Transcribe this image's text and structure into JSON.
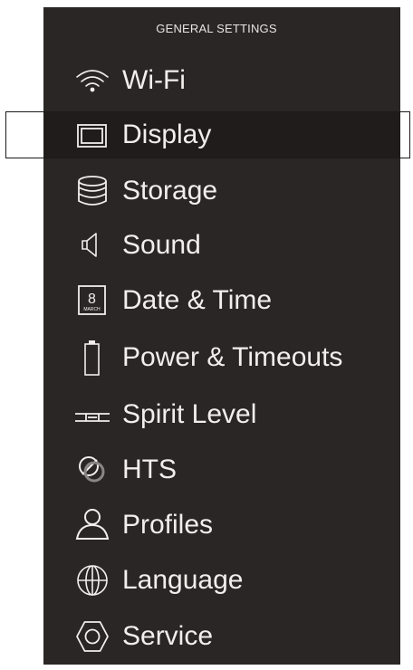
{
  "header": {
    "title": "GENERAL SETTINGS"
  },
  "menu": {
    "selected_index": 1,
    "items": [
      {
        "label": "Wi-Fi",
        "icon": "wifi-icon"
      },
      {
        "label": "Display",
        "icon": "display-icon"
      },
      {
        "label": "Storage",
        "icon": "storage-icon"
      },
      {
        "label": "Sound",
        "icon": "speaker-icon"
      },
      {
        "label": "Date & Time",
        "icon": "calendar-icon",
        "icon_text": {
          "day": "8",
          "month": "MARCH"
        }
      },
      {
        "label": "Power & Timeouts",
        "icon": "battery-icon"
      },
      {
        "label": "Spirit Level",
        "icon": "spirit-level-icon"
      },
      {
        "label": "HTS",
        "icon": "hts-icon"
      },
      {
        "label": "Profiles",
        "icon": "profile-icon"
      },
      {
        "label": "Language",
        "icon": "globe-icon"
      },
      {
        "label": "Service",
        "icon": "service-icon"
      }
    ]
  },
  "colors": {
    "panel_bg": "#2a2625",
    "text": "#f1eeec",
    "selection_border": "#1a1a1a"
  }
}
